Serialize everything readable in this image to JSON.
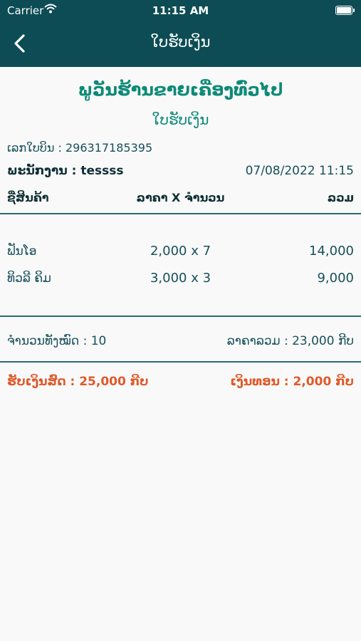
{
  "status_bar": {
    "carrier": "Carrier",
    "time": "11:15 AM"
  },
  "nav": {
    "title": "ໃບຮັບເງິນ"
  },
  "receipt": {
    "shop_name": "ພູວັນຮ້ານຂາຍເຄື່ອງທົ່ວໄປ",
    "subtitle": "ໃບຮັບເງິນ",
    "bill_no": "ເລກໃບບິນ : 296317185395",
    "employee": "ພະນັກງານ : tessss",
    "datetime": "07/08/2022 11:15",
    "headers": {
      "item": "ຊື່ສິນຄ້າ",
      "price_qty": "ລາຄາ X ຈຳນວນ",
      "total": "ລວມ"
    },
    "items": [
      {
        "name": "ຟັນໂອ",
        "price_qty": "2,000 x 7",
        "total": "14,000"
      },
      {
        "name": "ທິວລີ ຄິມ",
        "price_qty": "3,000 x 3",
        "total": "9,000"
      }
    ],
    "total_qty": "ຈຳນວນທັງໝົດ : 10",
    "total_price": "ລາຄາລວມ : 23,000 ກີບ",
    "received": "ຮັບເງິນສົດ : 25,000 ກີບ",
    "change": "ເງິນທອນ : 2,000 ກີບ"
  }
}
